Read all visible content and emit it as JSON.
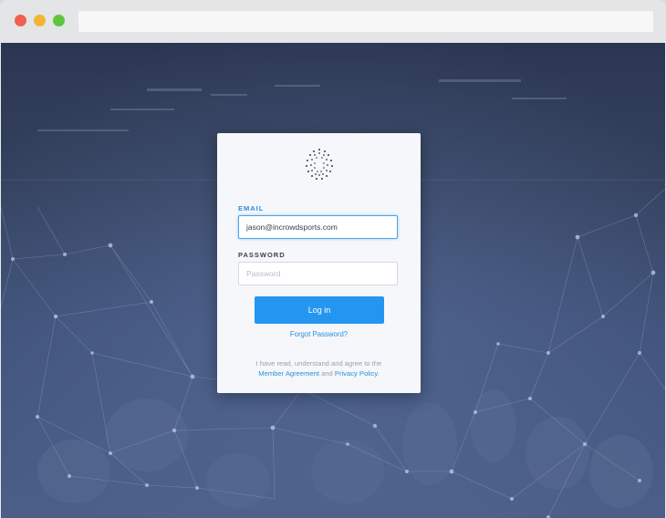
{
  "login": {
    "email_label": "EMAIL",
    "email_value": "jason@incrowdsports.com",
    "password_label": "PASSWORD",
    "password_placeholder": "Password",
    "login_button": "Log in",
    "forgot_password": "Forgot Password?",
    "terms_prefix": "I have read, understand and agree to the",
    "member_agreement": "Member Agreement",
    "terms_and": "and",
    "privacy_policy": "Privacy Policy",
    "terms_suffix": "."
  },
  "colors": {
    "accent": "#2596f0",
    "background_dark": "#2b3652",
    "background_light": "#4b5f88"
  },
  "icons": {
    "logo": "stadium-dots-logo"
  }
}
